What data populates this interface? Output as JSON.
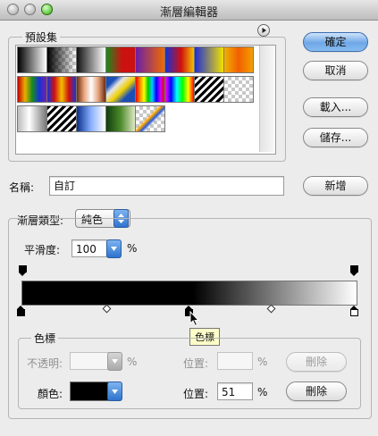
{
  "window": {
    "title": "漸層編輯器"
  },
  "buttons": {
    "ok": "確定",
    "cancel": "取消",
    "load": "載入...",
    "save": "儲存...",
    "new": "新增",
    "delete_opacity": "刪除",
    "delete_color": "刪除"
  },
  "presets": {
    "label": "預設集",
    "menu_icon": "triangle-right-icon"
  },
  "name": {
    "label": "名稱:",
    "value": "自訂"
  },
  "gradient_type": {
    "label": "漸層類型:",
    "value": "純色"
  },
  "smoothness": {
    "label": "平滑度:",
    "value": "100",
    "unit": "%"
  },
  "stops": {
    "group_label": "色標",
    "opacity_label": "不透明:",
    "opacity_value": "",
    "opacity_unit": "%",
    "opacity_location_label": "位置:",
    "opacity_location_value": "",
    "opacity_location_unit": "%",
    "color_label": "顏色:",
    "color_value": "#000000",
    "color_location_label": "位置:",
    "color_location_value": "51",
    "color_location_unit": "%"
  },
  "tooltip": {
    "text": "色標"
  }
}
